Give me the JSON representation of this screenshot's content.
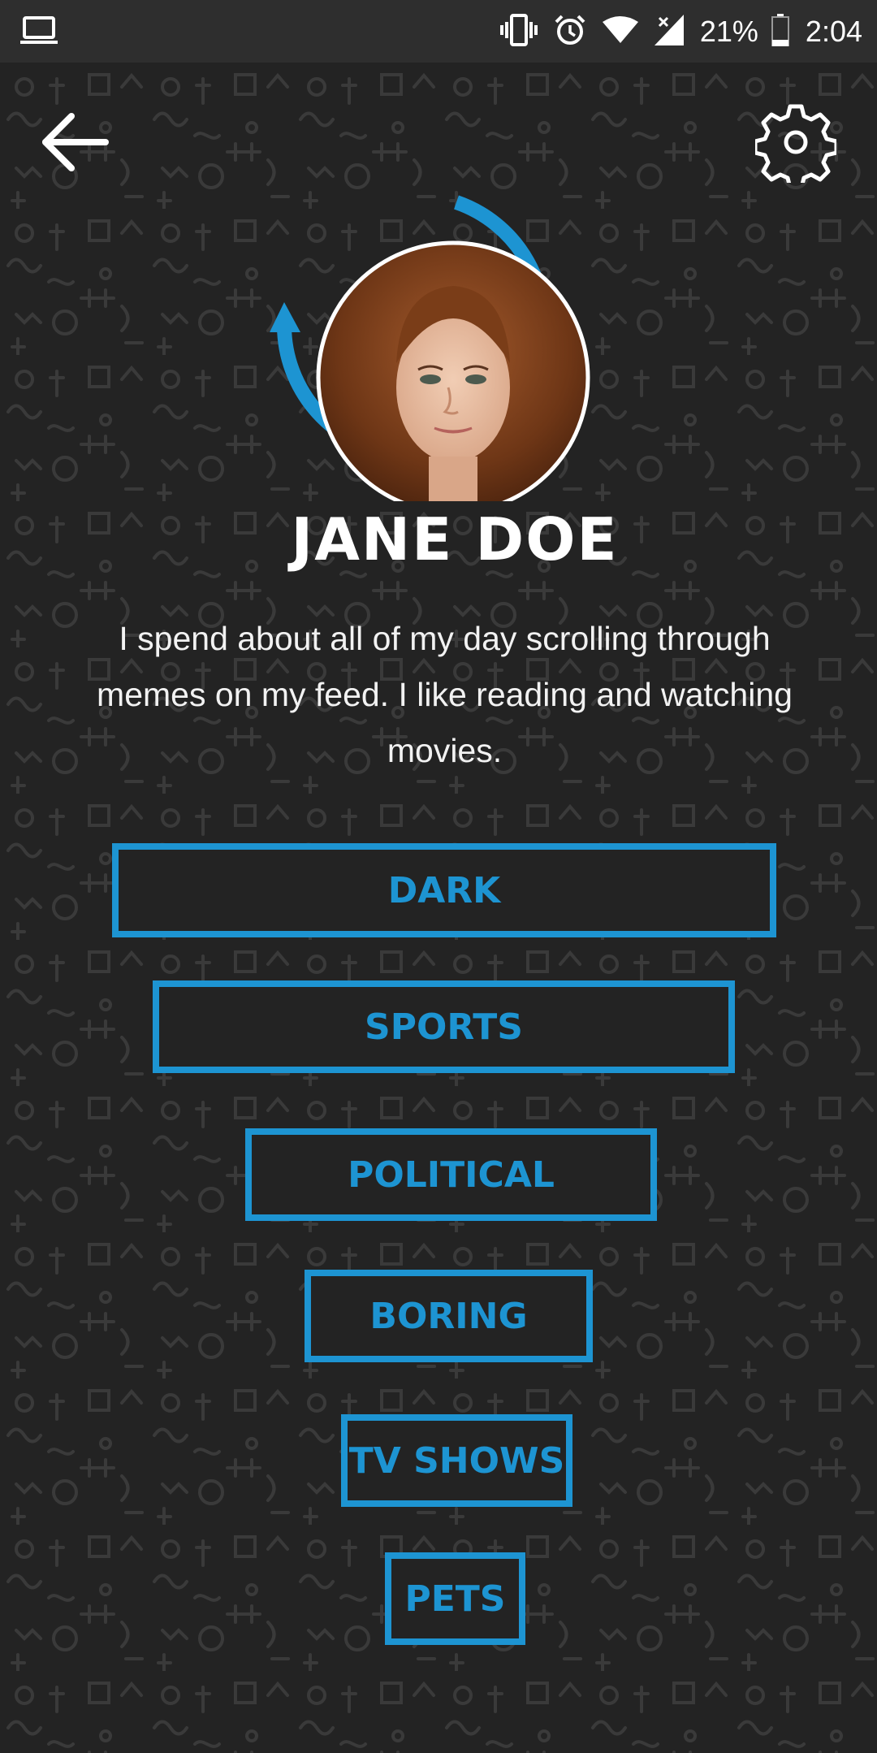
{
  "status_bar": {
    "left_icon": "laptop-icon",
    "icons": [
      "vibrate-icon",
      "alarm-icon",
      "wifi-icon",
      "cell-signal-icon",
      "battery-icon"
    ],
    "battery": "21%",
    "time": "2:04"
  },
  "header": {
    "back_icon": "arrow-left-icon",
    "settings_icon": "gear-icon"
  },
  "profile": {
    "name": "JANE DOE",
    "bio": "I spend about all of my day scrolling through memes on my feed. I like reading and watching movies."
  },
  "tags": [
    "DARK",
    "SPORTS",
    "POLITICAL",
    "BORING",
    "TV SHOWS",
    "PETS"
  ],
  "colors": {
    "accent": "#1d94d2",
    "background": "#232323",
    "status_bar": "#2e2e2e",
    "text": "#ffffff"
  }
}
